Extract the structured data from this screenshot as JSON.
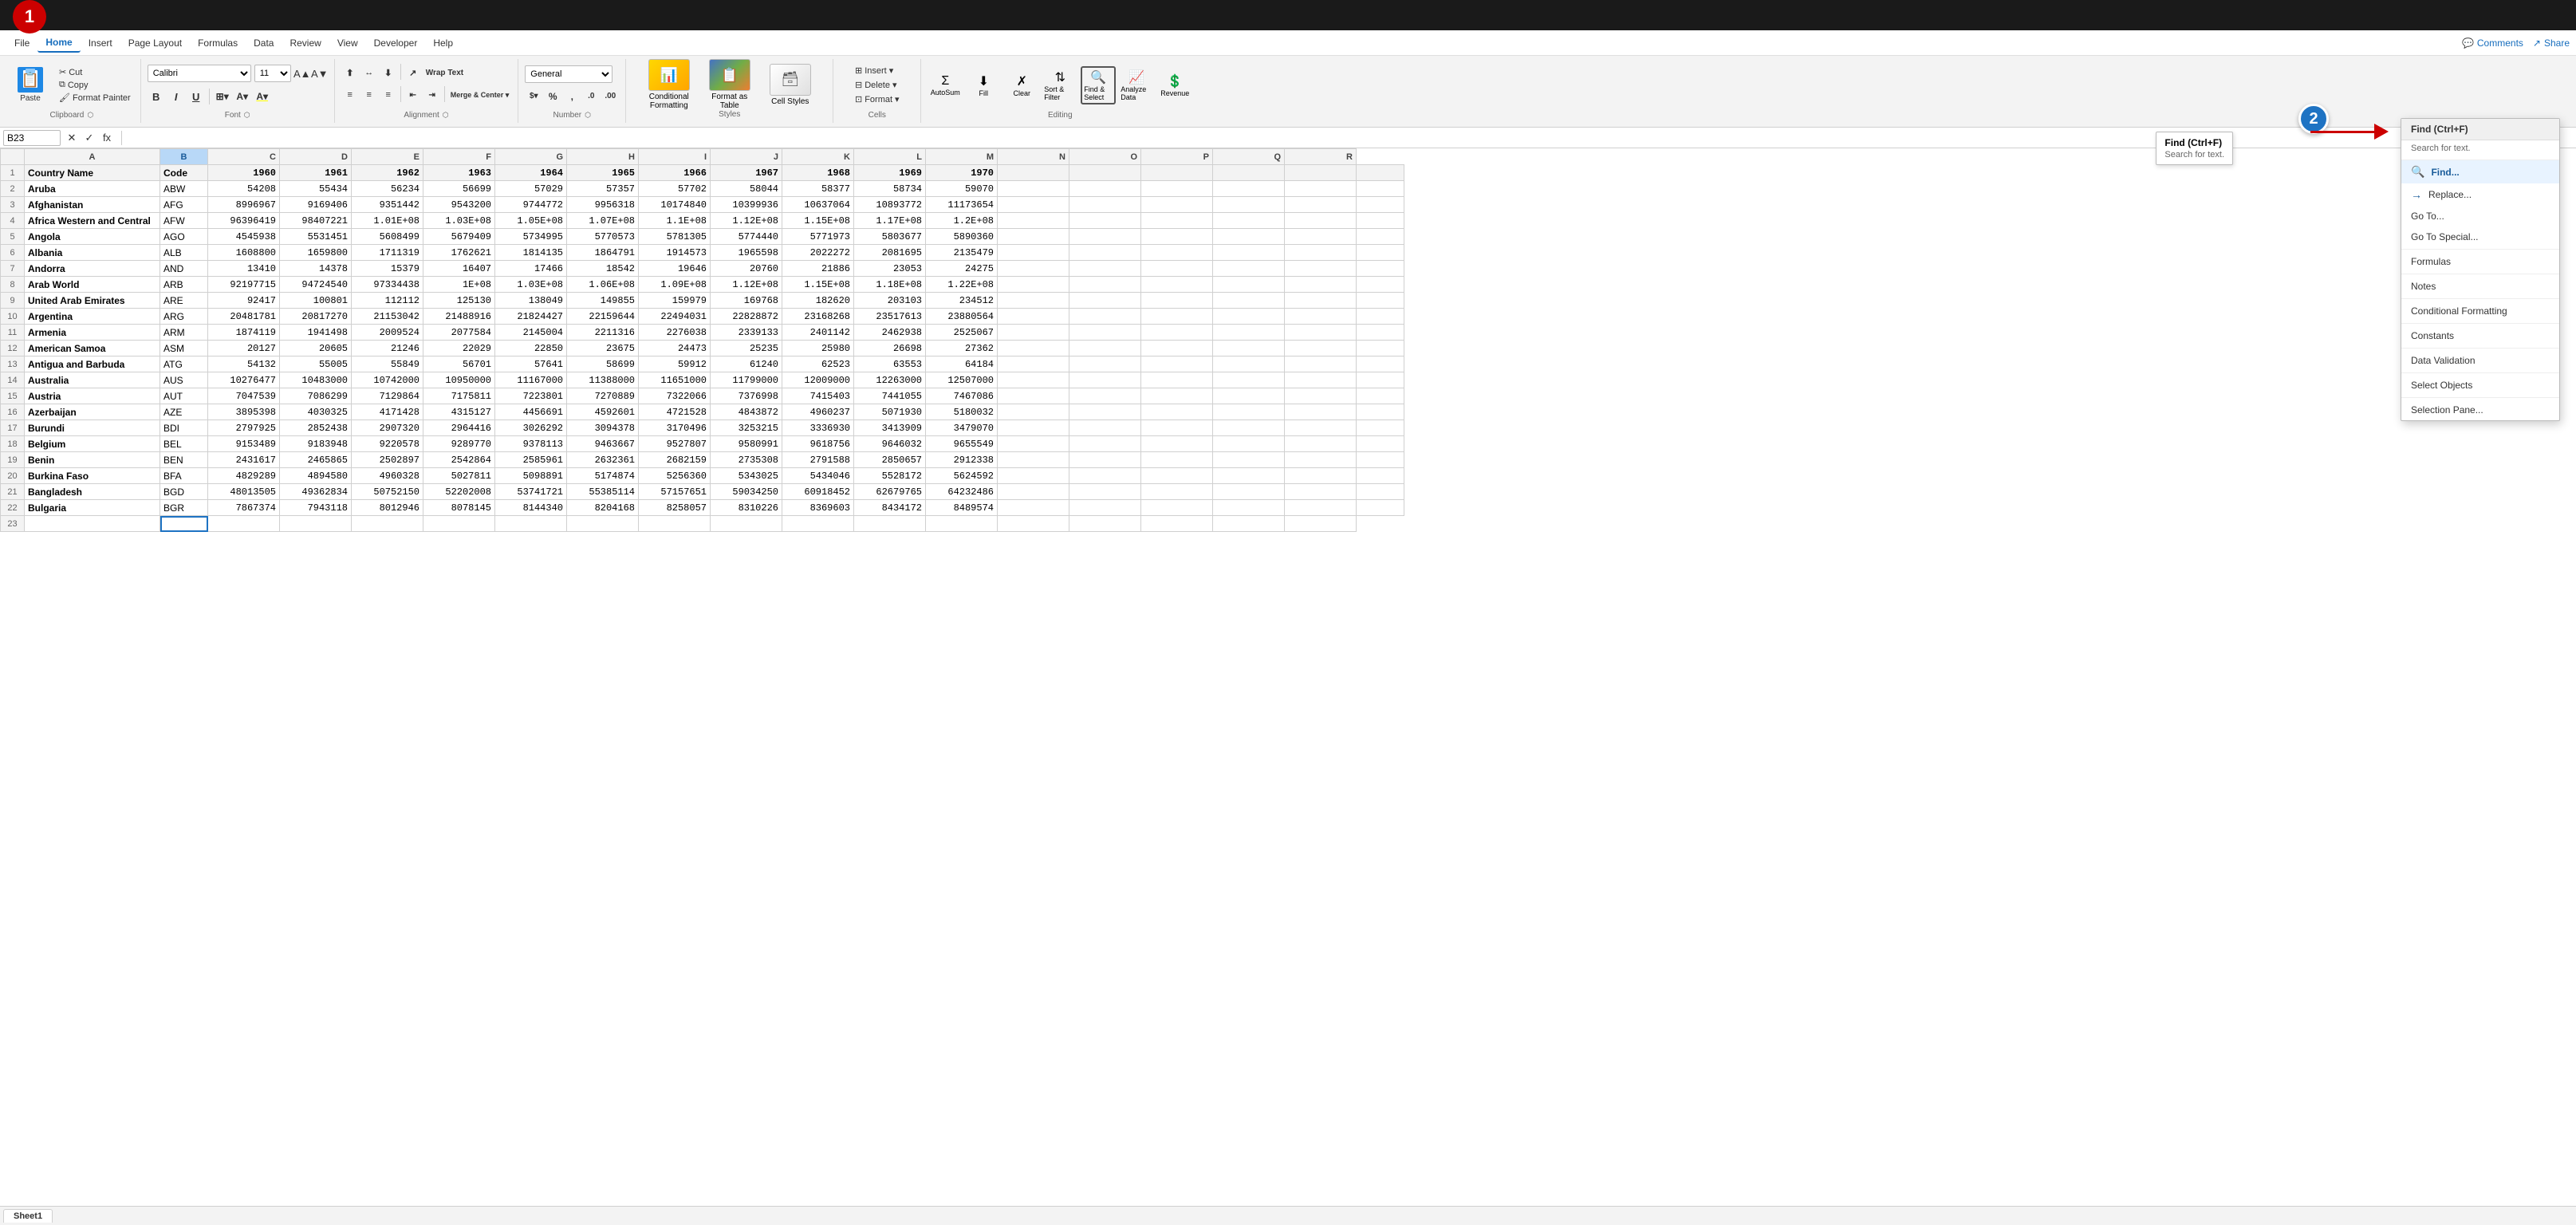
{
  "topBar": {
    "badge1": "1"
  },
  "menuBar": {
    "items": [
      "File",
      "Home",
      "Insert",
      "Page Layout",
      "Formulas",
      "Data",
      "Review",
      "View",
      "Developer",
      "Help"
    ],
    "activeItem": "Home",
    "rightItems": [
      "Comments",
      "Share"
    ]
  },
  "ribbon": {
    "clipboard": {
      "label": "Clipboard",
      "paste": "Paste",
      "cut": "Cut",
      "copy": "Copy",
      "formatPainter": "Format Painter"
    },
    "font": {
      "label": "Font",
      "fontName": "Calibri",
      "fontSize": "11",
      "bold": "B",
      "italic": "I",
      "underline": "U"
    },
    "alignment": {
      "label": "Alignment",
      "wrapText": "Wrap Text",
      "mergeCenter": "Merge & Center"
    },
    "number": {
      "label": "Number",
      "format": "General"
    },
    "styles": {
      "label": "Styles",
      "conditionalFormatting": "Conditional Formatting",
      "formatAsTable": "Format as Table",
      "cellStyles": "Cell Styles"
    },
    "cells": {
      "label": "Cells",
      "insert": "Insert",
      "delete": "Delete",
      "format": "Format"
    },
    "editing": {
      "label": "Editing",
      "autoSum": "AutoSum",
      "fill": "Fill",
      "clear": "Clear",
      "sortFilter": "Sort & Filter",
      "findSelect": "Find & Select",
      "analyzeData": "Analyze Data",
      "revenue": "Revenue"
    }
  },
  "formulaBar": {
    "cellRef": "B23",
    "formula": ""
  },
  "findTooltip": {
    "title": "Find (Ctrl+F)",
    "subtitle": "Search for text."
  },
  "dropdown": {
    "header": "Find (Ctrl+F)",
    "subtext": "Search for text.",
    "items": [
      {
        "label": "Find...",
        "active": true,
        "arrow": true
      },
      {
        "label": "Replace...",
        "active": false,
        "arrow": true
      },
      {
        "label": "Go To...",
        "active": false,
        "arrow": false
      },
      {
        "label": "Go To Special...",
        "active": false,
        "arrow": false
      },
      {
        "separator": true
      },
      {
        "label": "Formulas",
        "active": false,
        "arrow": false
      },
      {
        "separator": true
      },
      {
        "label": "Notes",
        "active": false,
        "arrow": false
      },
      {
        "separator": true
      },
      {
        "label": "Conditional Formatting",
        "active": false,
        "arrow": false
      },
      {
        "separator": true
      },
      {
        "label": "Constants",
        "active": false,
        "arrow": false
      },
      {
        "separator": true
      },
      {
        "label": "Data Validation",
        "active": false,
        "arrow": false
      },
      {
        "separator": true
      },
      {
        "label": "Select Objects",
        "active": false,
        "arrow": false
      },
      {
        "separator": true
      },
      {
        "label": "Selection Pane...",
        "active": false,
        "arrow": false
      }
    ]
  },
  "spreadsheet": {
    "activeCell": "B23",
    "columns": [
      "A",
      "B",
      "C",
      "D",
      "E",
      "F",
      "G",
      "H",
      "I",
      "J",
      "K",
      "L",
      "M",
      "N",
      "O",
      "P",
      "Q",
      "R"
    ],
    "rows": [
      {
        "num": 1,
        "cells": [
          "Country Name",
          "Code",
          "1960",
          "1961",
          "1962",
          "1963",
          "1964",
          "1965",
          "1966",
          "1967",
          "1968",
          "1969",
          "1970",
          "",
          "",
          "",
          "",
          "",
          ""
        ]
      },
      {
        "num": 2,
        "cells": [
          "Aruba",
          "ABW",
          "54208",
          "55434",
          "56234",
          "56699",
          "57029",
          "57357",
          "57702",
          "58044",
          "58377",
          "58734",
          "59070",
          "",
          "",
          "",
          "",
          "",
          ""
        ]
      },
      {
        "num": 3,
        "cells": [
          "Afghanistan",
          "AFG",
          "8996967",
          "9169406",
          "9351442",
          "9543200",
          "9744772",
          "9956318",
          "10174840",
          "10399936",
          "10637064",
          "10893772",
          "11173654",
          "",
          "",
          "",
          "",
          "",
          ""
        ]
      },
      {
        "num": 4,
        "cells": [
          "Africa Western and Central",
          "AFW",
          "96396419",
          "98407221",
          "1.01E+08",
          "1.03E+08",
          "1.05E+08",
          "1.07E+08",
          "1.1E+08",
          "1.12E+08",
          "1.15E+08",
          "1.17E+08",
          "1.2E+08",
          "",
          "",
          "",
          "",
          "",
          ""
        ]
      },
      {
        "num": 5,
        "cells": [
          "Angola",
          "AGO",
          "4545938",
          "5531451",
          "5608499",
          "5679409",
          "5734995",
          "5770573",
          "5781305",
          "5774440",
          "5771973",
          "5803677",
          "5890360",
          "",
          "",
          "",
          "",
          "",
          ""
        ]
      },
      {
        "num": 6,
        "cells": [
          "Albania",
          "ALB",
          "1608800",
          "1659800",
          "1711319",
          "1762621",
          "1814135",
          "1864791",
          "1914573",
          "1965598",
          "2022272",
          "2081695",
          "2135479",
          "",
          "",
          "",
          "",
          "",
          ""
        ]
      },
      {
        "num": 7,
        "cells": [
          "Andorra",
          "AND",
          "13410",
          "14378",
          "15379",
          "16407",
          "17466",
          "18542",
          "19646",
          "20760",
          "21886",
          "23053",
          "24275",
          "",
          "",
          "",
          "",
          "",
          ""
        ]
      },
      {
        "num": 8,
        "cells": [
          "Arab World",
          "ARB",
          "92197715",
          "94724540",
          "97334438",
          "1E+08",
          "1.03E+08",
          "1.06E+08",
          "1.09E+08",
          "1.12E+08",
          "1.15E+08",
          "1.18E+08",
          "1.22E+08",
          "",
          "",
          "",
          "",
          "",
          ""
        ]
      },
      {
        "num": 9,
        "cells": [
          "United Arab Emirates",
          "ARE",
          "92417",
          "100801",
          "112112",
          "125130",
          "138049",
          "149855",
          "159979",
          "169768",
          "182620",
          "203103",
          "234512",
          "",
          "",
          "",
          "",
          "",
          ""
        ]
      },
      {
        "num": 10,
        "cells": [
          "Argentina",
          "ARG",
          "20481781",
          "20817270",
          "21153042",
          "21488916",
          "21824427",
          "22159644",
          "22494031",
          "22828872",
          "23168268",
          "23517613",
          "23880564",
          "",
          "",
          "",
          "",
          "",
          ""
        ]
      },
      {
        "num": 11,
        "cells": [
          "Armenia",
          "ARM",
          "1874119",
          "1941498",
          "2009524",
          "2077584",
          "2145004",
          "2211316",
          "2276038",
          "2339133",
          "2401142",
          "2462938",
          "2525067",
          "",
          "",
          "",
          "",
          "",
          ""
        ]
      },
      {
        "num": 12,
        "cells": [
          "American Samoa",
          "ASM",
          "20127",
          "20605",
          "21246",
          "22029",
          "22850",
          "23675",
          "24473",
          "25235",
          "25980",
          "26698",
          "27362",
          "",
          "",
          "",
          "",
          "",
          ""
        ]
      },
      {
        "num": 13,
        "cells": [
          "Antigua and Barbuda",
          "ATG",
          "54132",
          "55005",
          "55849",
          "56701",
          "57641",
          "58699",
          "59912",
          "61240",
          "62523",
          "63553",
          "64184",
          "",
          "",
          "",
          "",
          "",
          ""
        ]
      },
      {
        "num": 14,
        "cells": [
          "Australia",
          "AUS",
          "10276477",
          "10483000",
          "10742000",
          "10950000",
          "11167000",
          "11388000",
          "11651000",
          "11799000",
          "12009000",
          "12263000",
          "12507000",
          "",
          "",
          "",
          "",
          "",
          ""
        ]
      },
      {
        "num": 15,
        "cells": [
          "Austria",
          "AUT",
          "7047539",
          "7086299",
          "7129864",
          "7175811",
          "7223801",
          "7270889",
          "7322066",
          "7376998",
          "7415403",
          "7441055",
          "7467086",
          "",
          "",
          "",
          "",
          "",
          ""
        ]
      },
      {
        "num": 16,
        "cells": [
          "Azerbaijan",
          "AZE",
          "3895398",
          "4030325",
          "4171428",
          "4315127",
          "4456691",
          "4592601",
          "4721528",
          "4843872",
          "4960237",
          "5071930",
          "5180032",
          "",
          "",
          "",
          "",
          "",
          ""
        ]
      },
      {
        "num": 17,
        "cells": [
          "Burundi",
          "BDI",
          "2797925",
          "2852438",
          "2907320",
          "2964416",
          "3026292",
          "3094378",
          "3170496",
          "3253215",
          "3336930",
          "3413909",
          "3479070",
          "",
          "",
          "",
          "",
          "",
          ""
        ]
      },
      {
        "num": 18,
        "cells": [
          "Belgium",
          "BEL",
          "9153489",
          "9183948",
          "9220578",
          "9289770",
          "9378113",
          "9463667",
          "9527807",
          "9580991",
          "9618756",
          "9646032",
          "9655549",
          "",
          "",
          "",
          "",
          "",
          ""
        ]
      },
      {
        "num": 19,
        "cells": [
          "Benin",
          "BEN",
          "2431617",
          "2465865",
          "2502897",
          "2542864",
          "2585961",
          "2632361",
          "2682159",
          "2735308",
          "2791588",
          "2850657",
          "2912338",
          "",
          "",
          "",
          "",
          "",
          ""
        ]
      },
      {
        "num": 20,
        "cells": [
          "Burkina Faso",
          "BFA",
          "4829289",
          "4894580",
          "4960328",
          "5027811",
          "5098891",
          "5174874",
          "5256360",
          "5343025",
          "5434046",
          "5528172",
          "5624592",
          "",
          "",
          "",
          "",
          "",
          ""
        ]
      },
      {
        "num": 21,
        "cells": [
          "Bangladesh",
          "BGD",
          "48013505",
          "49362834",
          "50752150",
          "52202008",
          "53741721",
          "55385114",
          "57157651",
          "59034250",
          "60918452",
          "62679765",
          "64232486",
          "",
          "",
          "",
          "",
          "",
          ""
        ]
      },
      {
        "num": 22,
        "cells": [
          "Bulgaria",
          "BGR",
          "7867374",
          "7943118",
          "8012946",
          "8078145",
          "8144340",
          "8204168",
          "8258057",
          "8310226",
          "8369603",
          "8434172",
          "8489574",
          "",
          "",
          "",
          "",
          "",
          ""
        ]
      },
      {
        "num": 23,
        "cells": [
          "",
          "",
          "",
          "",
          "",
          "",
          "",
          "",
          "",
          "",
          "",
          "",
          "",
          "",
          "",
          "",
          "",
          ""
        ]
      }
    ]
  },
  "badge2": "2"
}
